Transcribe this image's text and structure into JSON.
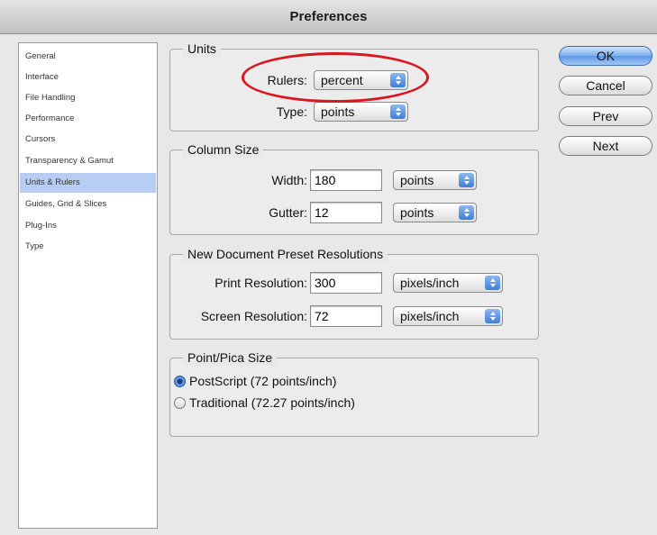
{
  "window": {
    "title": "Preferences"
  },
  "sidebar": {
    "items": [
      {
        "label": "General"
      },
      {
        "label": "Interface"
      },
      {
        "label": "File Handling"
      },
      {
        "label": "Performance"
      },
      {
        "label": "Cursors"
      },
      {
        "label": "Transparency & Gamut"
      },
      {
        "label": "Units & Rulers",
        "selected": true
      },
      {
        "label": "Guides, Grid & Slices"
      },
      {
        "label": "Plug-Ins"
      },
      {
        "label": "Type"
      }
    ]
  },
  "units": {
    "title": "Units",
    "rulers_label": "Rulers:",
    "rulers_value": "percent",
    "type_label": "Type:",
    "type_value": "points"
  },
  "column_size": {
    "title": "Column Size",
    "width_label": "Width:",
    "width_value": "180",
    "width_unit": "points",
    "gutter_label": "Gutter:",
    "gutter_value": "12",
    "gutter_unit": "points"
  },
  "resolutions": {
    "title": "New Document Preset Resolutions",
    "print_label": "Print Resolution:",
    "print_value": "300",
    "print_unit": "pixels/inch",
    "screen_label": "Screen Resolution:",
    "screen_value": "72",
    "screen_unit": "pixels/inch"
  },
  "point_pica": {
    "title": "Point/Pica Size",
    "options": [
      {
        "label": "PostScript (72 points/inch)",
        "selected": true
      },
      {
        "label": "Traditional (72.27 points/inch)",
        "selected": false
      }
    ]
  },
  "buttons": {
    "ok": "OK",
    "cancel": "Cancel",
    "prev": "Prev",
    "next": "Next"
  },
  "colors": {
    "selection": "#b8cdf2",
    "highlight_circle": "#d8171f",
    "default_button": "#5c97e6"
  }
}
